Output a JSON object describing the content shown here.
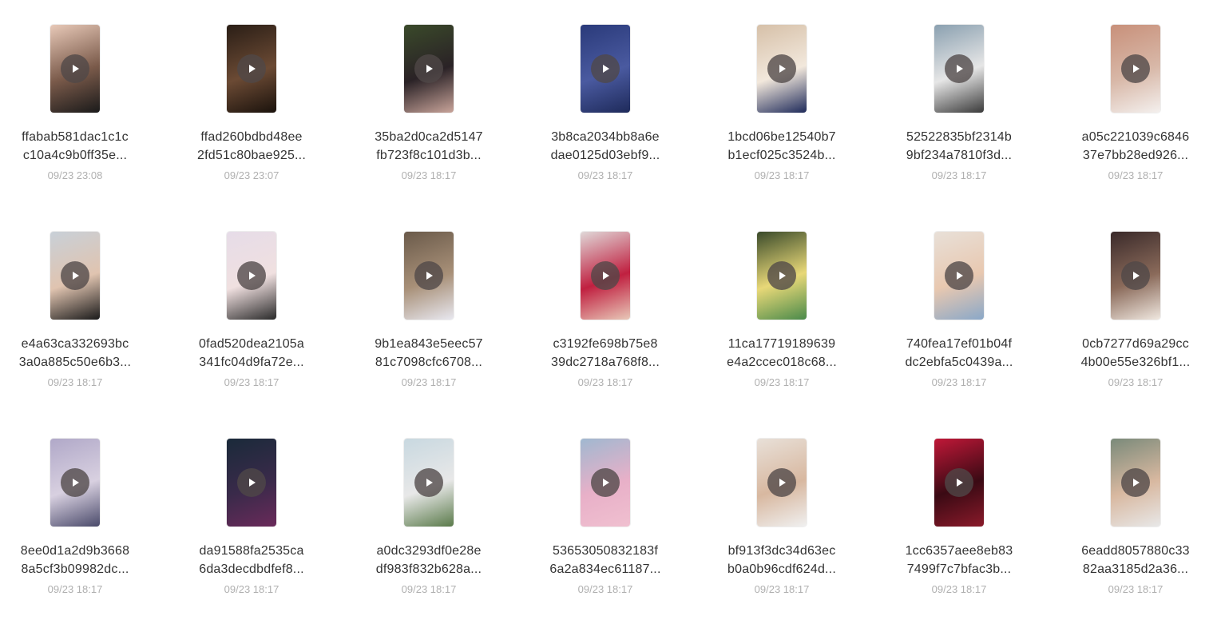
{
  "play_icon": "play-icon",
  "rows": [
    [
      {
        "name1": "ffabab581dac1c1c",
        "name2": "c10a4c9b0ff35e...",
        "date": "09/23 23:08",
        "colors": [
          "#e8c9b8",
          "#7a5a4a",
          "#1a1a1a"
        ]
      },
      {
        "name1": "ffad260bdbd48ee",
        "name2": "2fd51c80bae925...",
        "date": "09/23 23:07",
        "colors": [
          "#2a1e16",
          "#6b4a34",
          "#1a120c"
        ]
      },
      {
        "name1": "35ba2d0ca2d5147",
        "name2": "fb723f8c101d3b...",
        "date": "09/23 18:17",
        "colors": [
          "#3a4a2a",
          "#2a2226",
          "#c9a49a"
        ]
      },
      {
        "name1": "3b8ca2034bb8a6e",
        "name2": "dae0125d03ebf9...",
        "date": "09/23 18:17",
        "colors": [
          "#2a3a7a",
          "#4a5aa0",
          "#1e2a5a"
        ]
      },
      {
        "name1": "1bcd06be12540b7",
        "name2": "b1ecf025c3524b...",
        "date": "09/23 18:17",
        "colors": [
          "#d6c0a8",
          "#f2e8dc",
          "#1e2a5a"
        ]
      },
      {
        "name1": "52522835bf2314b",
        "name2": "9bf234a7810f3d...",
        "date": "09/23 18:17",
        "colors": [
          "#8aa0b0",
          "#e6e6e6",
          "#3a3a3a"
        ]
      },
      {
        "name1": "a05c221039c6846",
        "name2": "37e7bb28ed926...",
        "date": "09/23 18:17",
        "colors": [
          "#c8907a",
          "#d8b8a8",
          "#f4f0ee"
        ]
      }
    ],
    [
      {
        "name1": "e4a63ca332693bc",
        "name2": "3a0a885c50e6b3...",
        "date": "09/23 18:17",
        "colors": [
          "#c8d0d8",
          "#e0c4b0",
          "#1a1a1a"
        ]
      },
      {
        "name1": "0fad520dea2105a",
        "name2": "341fc04d9fa72e...",
        "date": "09/23 18:17",
        "colors": [
          "#e6dce8",
          "#f0e0e0",
          "#2a2a2a"
        ]
      },
      {
        "name1": "9b1ea843e5eec57",
        "name2": "81c7098cfc6708...",
        "date": "09/23 18:17",
        "colors": [
          "#6a5a4a",
          "#a89078",
          "#e8e8f0"
        ]
      },
      {
        "name1": "c3192fe698b75e8",
        "name2": "39dc2718a768f8...",
        "date": "09/23 18:17",
        "colors": [
          "#e0d8d8",
          "#c02040",
          "#e8c8b8"
        ]
      },
      {
        "name1": "11ca17719189639",
        "name2": "e4a2ccec018c68...",
        "date": "09/23 18:17",
        "colors": [
          "#3a4a2a",
          "#e8d878",
          "#4a8a4a"
        ]
      },
      {
        "name1": "740fea17ef01b04f",
        "name2": "dc2ebfa5c0439a...",
        "date": "09/23 18:17",
        "colors": [
          "#e8e0d8",
          "#e8c8b0",
          "#8aa8c8"
        ]
      },
      {
        "name1": "0cb7277d69a29cc",
        "name2": "4b00e55e326bf1...",
        "date": "09/23 18:17",
        "colors": [
          "#3a2a2a",
          "#8a6a5a",
          "#f0e8e0"
        ]
      }
    ],
    [
      {
        "name1": "8ee0d1a2d9b3668",
        "name2": "8a5cf3b09982dc...",
        "date": "09/23 18:17",
        "colors": [
          "#b0a8c8",
          "#d8d0e0",
          "#4a4a6a"
        ]
      },
      {
        "name1": "da91588fa2535ca",
        "name2": "6da3decdbdfef8...",
        "date": "09/23 18:17",
        "colors": [
          "#1a2a3a",
          "#3a2a4a",
          "#6a2a5a"
        ]
      },
      {
        "name1": "a0dc3293df0e28e",
        "name2": "df983f832b628a...",
        "date": "09/23 18:17",
        "colors": [
          "#c8d8e0",
          "#e8e8e8",
          "#5a7a4a"
        ]
      },
      {
        "name1": "53653050832183f",
        "name2": "6a2a834ec61187...",
        "date": "09/23 18:17",
        "colors": [
          "#a0b8d0",
          "#e8b0c8",
          "#f0c0d0"
        ]
      },
      {
        "name1": "bf913f3dc34d63ec",
        "name2": "b0a0b96cdf624d...",
        "date": "09/23 18:17",
        "colors": [
          "#e8e0d8",
          "#d8b8a0",
          "#f0f0f0"
        ]
      },
      {
        "name1": "1cc6357aee8eb83",
        "name2": "7499f7c7bfac3b...",
        "date": "09/23 18:17",
        "colors": [
          "#c01838",
          "#3a0a14",
          "#8a1a2a"
        ]
      },
      {
        "name1": "6eadd8057880c33",
        "name2": "82aa3185d2a36...",
        "date": "09/23 18:17",
        "colors": [
          "#7a8a7a",
          "#d8b8a0",
          "#e8e8e8"
        ]
      }
    ]
  ]
}
